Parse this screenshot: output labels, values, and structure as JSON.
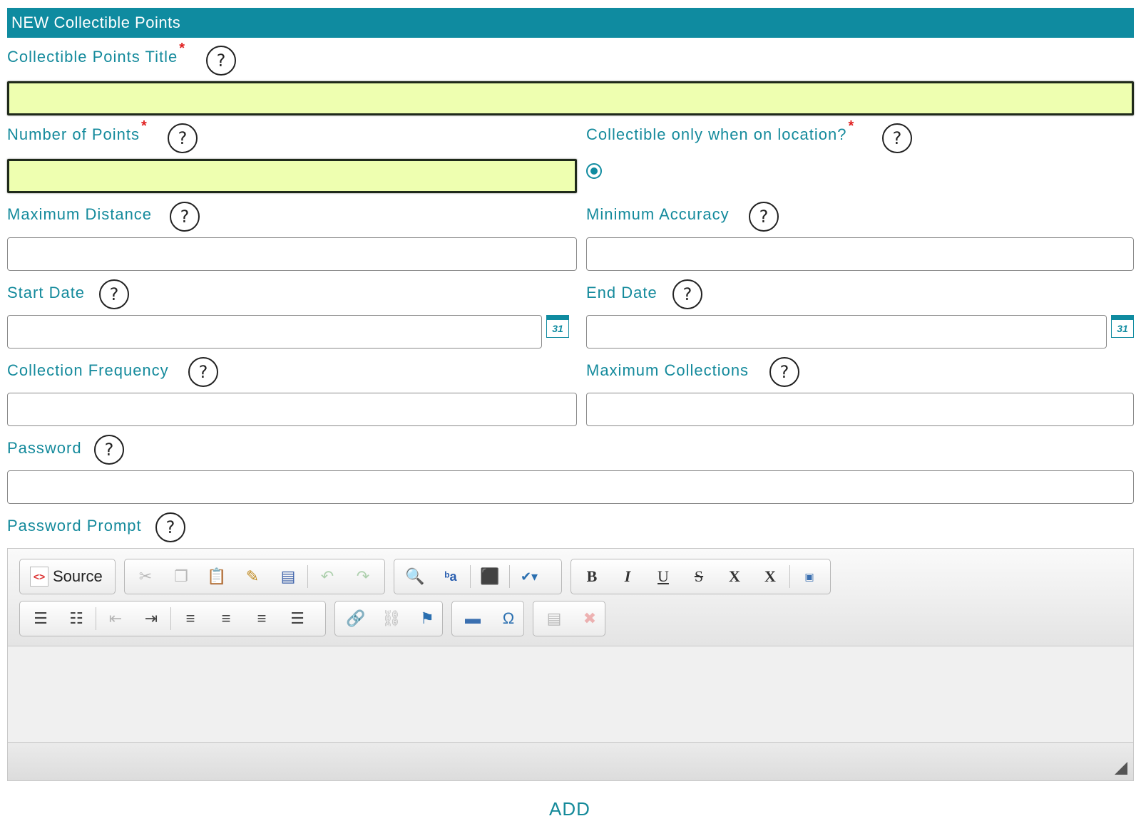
{
  "header": {
    "title": "NEW Collectible Points"
  },
  "fields": {
    "title": {
      "label": "Collectible Points Title",
      "required_mark": "*",
      "help": "?",
      "value": ""
    },
    "points": {
      "label": "Number of Points",
      "required_mark": "*",
      "help": "?",
      "value": ""
    },
    "on_location": {
      "label": "Collectible only when on location?",
      "required_mark": "*",
      "help": "?",
      "selected": true
    },
    "max_distance": {
      "label": "Maximum Distance",
      "help": "?",
      "value": ""
    },
    "min_accuracy": {
      "label": "Minimum Accuracy",
      "help": "?",
      "value": ""
    },
    "start_date": {
      "label": "Start Date",
      "help": "?",
      "value": "",
      "calendar": "31"
    },
    "end_date": {
      "label": "End Date",
      "help": "?",
      "value": "",
      "calendar": "31"
    },
    "frequency": {
      "label": "Collection Frequency",
      "help": "?",
      "value": ""
    },
    "max_collections": {
      "label": "Maximum Collections",
      "help": "?",
      "value": ""
    },
    "password": {
      "label": "Password",
      "help": "?",
      "value": ""
    },
    "password_prompt": {
      "label": "Password Prompt",
      "help": "?"
    }
  },
  "editor": {
    "source_label": "Source",
    "row1": [
      "cut-icon",
      "copy-icon",
      "paste-icon",
      "paste-text-icon",
      "paste-word-icon",
      "undo-icon",
      "redo-icon",
      "find-icon",
      "replace-icon",
      "select-all-icon",
      "spellcheck-icon",
      "bold-icon",
      "italic-icon",
      "underline-icon",
      "strike-icon",
      "subscript-icon",
      "superscript-icon",
      "html-icon"
    ],
    "row2": [
      "numbered-list-icon",
      "bullet-list-icon",
      "outdent-icon",
      "indent-icon",
      "align-left-icon",
      "align-center-icon",
      "align-right-icon",
      "justify-icon",
      "link-icon",
      "unlink-icon",
      "anchor-icon",
      "horizontal-rule-icon",
      "special-char-icon",
      "template-icon",
      "remove-format-icon"
    ],
    "symbols": {
      "bold": "B",
      "italic": "I",
      "underline": "U",
      "strike": "S",
      "subscript": "X",
      "superscript": "X",
      "omega": "Ω"
    }
  },
  "actions": {
    "add_label": "ADD"
  },
  "colors": {
    "accent": "#0f8ba0",
    "required_bg": "#eeffb0",
    "required_mark": "#e02020"
  }
}
